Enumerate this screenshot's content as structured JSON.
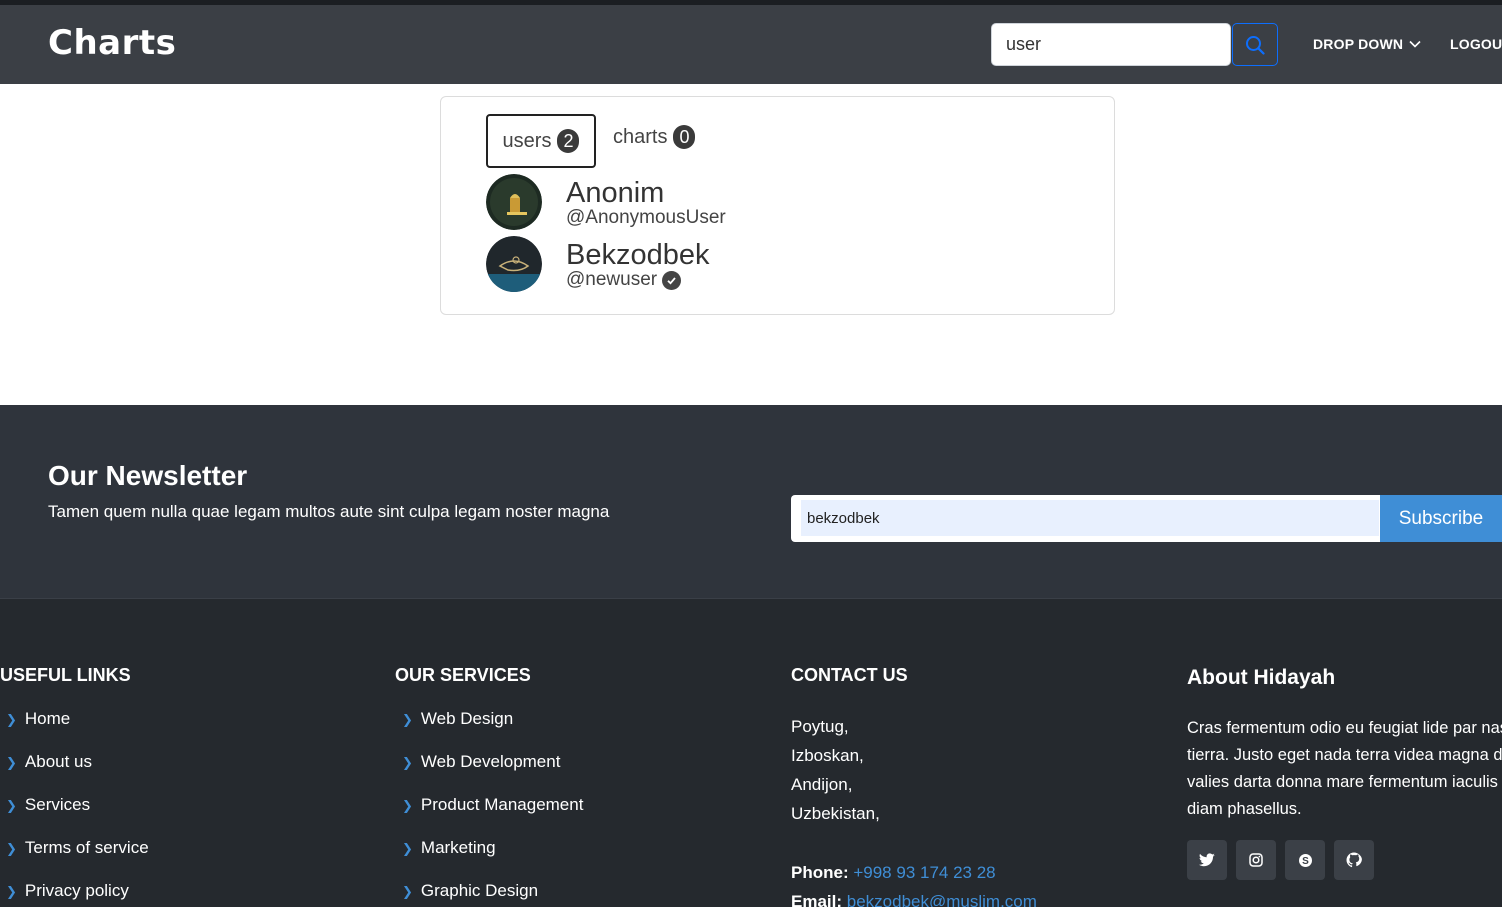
{
  "navbar": {
    "brand": "Charts",
    "search_value": "user",
    "dropdown_label": "DROP DOWN",
    "logout_label": "LOGOUT"
  },
  "results": {
    "tabs": [
      {
        "label": "users",
        "count": "2"
      },
      {
        "label": "charts",
        "count": "0"
      }
    ],
    "users": [
      {
        "name": "Anonim",
        "handle": "@AnonymousUser",
        "verified": false
      },
      {
        "name": "Bekzodbek",
        "handle": "@newuser",
        "verified": true
      }
    ]
  },
  "newsletter": {
    "title": "Our Newsletter",
    "text": "Tamen quem nulla quae legam multos aute sint culpa legam noster magna",
    "input_value": "bekzodbek",
    "button_label": "Subscribe"
  },
  "footer": {
    "useful_links": {
      "title": "USEFUL LINKS",
      "items": [
        "Home",
        "About us",
        "Services",
        "Terms of service",
        "Privacy policy"
      ]
    },
    "services": {
      "title": "OUR SERVICES",
      "items": [
        "Web Design",
        "Web Development",
        "Product Management",
        "Marketing",
        "Graphic Design"
      ]
    },
    "contact": {
      "title": "CONTACT US",
      "address": [
        "Poytug,",
        "Izboskan,",
        "Andijon,",
        "Uzbekistan,"
      ],
      "phone_label": "Phone:",
      "phone": "+998 93 174 23 28",
      "email_label": "Email:",
      "email": "bekzodbek@muslim.com"
    },
    "about": {
      "title": "About Hidayah",
      "lines": [
        "Cras fermentum odio eu feugiat lide par nas",
        "tierra. Justo eget nada terra videa magna de",
        "valies darta donna mare fermentum iaculis e",
        "diam phasellus."
      ]
    },
    "social": [
      "twitter-icon",
      "instagram-icon",
      "skype-icon",
      "github-icon"
    ]
  },
  "colors": {
    "navbar_bg": "#3b3f45",
    "newsletter_bg": "#2f343c",
    "footer_bg": "#25292e",
    "accent": "#3f8ed6"
  }
}
